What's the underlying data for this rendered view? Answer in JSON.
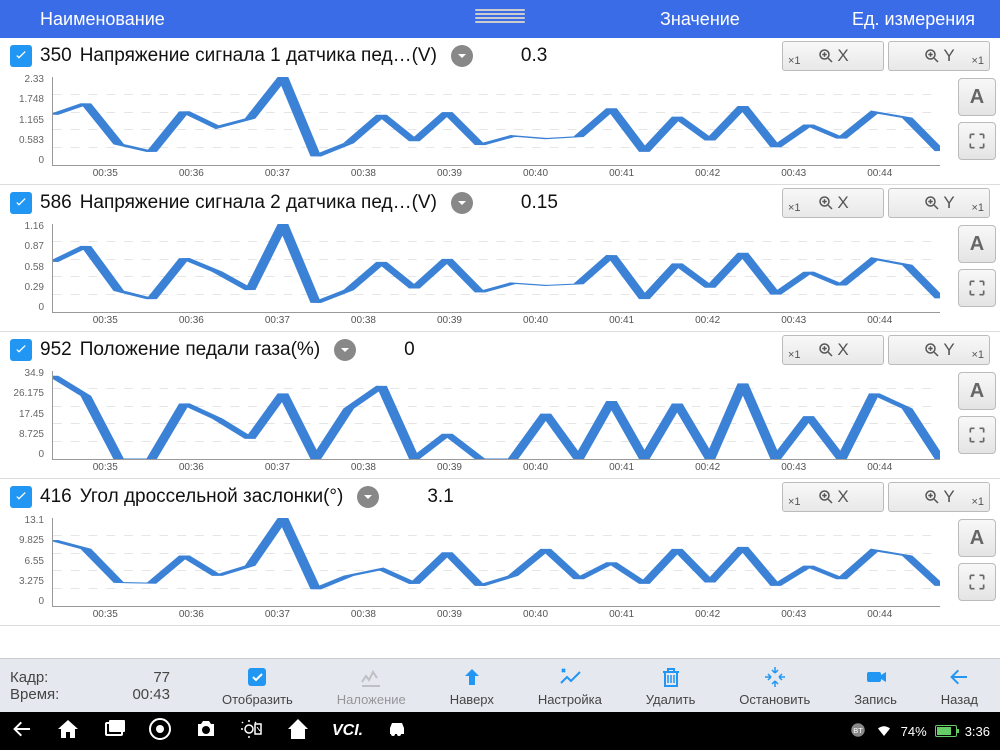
{
  "header": {
    "name": "Наименование",
    "value": "Значение",
    "unit": "Ед. измерения"
  },
  "zoom": {
    "xlabel": "X",
    "ylabel": "Y",
    "x1": "×1"
  },
  "panels": [
    {
      "id": "350",
      "name": "Напряжение сигнала 1 датчика пед…(V)",
      "value": "0.3",
      "yticks": [
        "2.33",
        "1.748",
        "1.165",
        "0.583",
        "0"
      ]
    },
    {
      "id": "586",
      "name": "Напряжение сигнала 2 датчика пед…(V)",
      "value": "0.15",
      "yticks": [
        "1.16",
        "0.87",
        "0.58",
        "0.29",
        "0"
      ]
    },
    {
      "id": "952",
      "name": "Положение педали газа(%)",
      "value": "0",
      "yticks": [
        "34.9",
        "26.175",
        "17.45",
        "8.725",
        "0"
      ]
    },
    {
      "id": "416",
      "name": "Угол дроссельной заслонки(°)",
      "value": "3.1",
      "yticks": [
        "13.1",
        "9.825",
        "6.55",
        "3.275",
        "0"
      ]
    }
  ],
  "xticks": [
    "00:35",
    "00:36",
    "00:37",
    "00:38",
    "00:39",
    "00:40",
    "00:41",
    "00:42",
    "00:43",
    "00:44"
  ],
  "chart_data": [
    {
      "type": "line",
      "title": "Напряжение сигнала 1 датчика пед…(V)",
      "ylim": [
        0,
        2.33
      ],
      "x": [
        "00:34.5",
        "00:34.8",
        "00:35.5",
        "00:35.8",
        "00:36.3",
        "00:36.7",
        "00:37.0",
        "00:37.3",
        "00:37.6",
        "00:38.0",
        "00:38.3",
        "00:38.6",
        "00:39.0",
        "00:39.3",
        "00:39.7",
        "00:40.0",
        "00:40.4",
        "00:40.7",
        "00:41.0",
        "00:41.4",
        "00:41.7",
        "00:42.0",
        "00:42.4",
        "00:42.7",
        "00:43.0",
        "00:43.4",
        "00:43.7",
        "00:44.0"
      ],
      "values": [
        1.33,
        1.63,
        0.55,
        0.35,
        1.42,
        1.0,
        1.23,
        2.33,
        0.23,
        0.58,
        1.33,
        0.63,
        1.4,
        0.53,
        0.77,
        0.7,
        0.75,
        1.5,
        0.35,
        1.28,
        0.65,
        1.56,
        0.47,
        1.07,
        0.7,
        1.4,
        1.25,
        0.37
      ]
    },
    {
      "type": "line",
      "title": "Напряжение сигнала 2 датчика пед…(V)",
      "ylim": [
        0,
        1.16
      ],
      "x": [
        "00:34.5",
        "00:34.8",
        "00:35.5",
        "00:35.8",
        "00:36.3",
        "00:36.7",
        "00:37.0",
        "00:37.3",
        "00:37.6",
        "00:38.0",
        "00:38.3",
        "00:38.6",
        "00:39.0",
        "00:39.3",
        "00:39.7",
        "00:40.0",
        "00:40.4",
        "00:40.7",
        "00:41.0",
        "00:41.4",
        "00:41.7",
        "00:42.0",
        "00:42.4",
        "00:42.7",
        "00:43.0",
        "00:43.4",
        "00:43.7",
        "00:44.0"
      ],
      "values": [
        0.66,
        0.87,
        0.28,
        0.17,
        0.71,
        0.53,
        0.29,
        1.16,
        0.12,
        0.29,
        0.66,
        0.31,
        0.7,
        0.26,
        0.38,
        0.35,
        0.37,
        0.75,
        0.17,
        0.64,
        0.32,
        0.78,
        0.23,
        0.53,
        0.35,
        0.7,
        0.62,
        0.18
      ]
    },
    {
      "type": "line",
      "title": "Положение педали газа(%)",
      "ylim": [
        0,
        34.9
      ],
      "x": [
        "00:34.5",
        "00:34.8",
        "00:35.5",
        "00:35.8",
        "00:36.3",
        "00:36.7",
        "00:37.0",
        "00:37.3",
        "00:37.6",
        "00:38.0",
        "00:38.3",
        "00:38.6",
        "00:39.0",
        "00:39.3",
        "00:39.7",
        "00:40.0",
        "00:40.4",
        "00:40.7",
        "00:41.0",
        "00:41.4",
        "00:41.7",
        "00:42.0",
        "00:42.4",
        "00:42.7",
        "00:43.0",
        "00:43.4",
        "00:43.7",
        "00:44.0"
      ],
      "values": [
        33,
        25,
        0,
        0,
        22,
        16,
        8,
        26,
        0,
        20,
        29,
        0,
        10,
        0,
        0,
        18,
        0,
        23,
        0,
        22,
        0,
        30,
        0,
        17,
        0,
        26,
        20,
        0
      ]
    },
    {
      "type": "line",
      "title": "Угол дроссельной заслонки(°)",
      "ylim": [
        0,
        13.1
      ],
      "x": [
        "00:34.5",
        "00:34.8",
        "00:35.5",
        "00:35.8",
        "00:36.3",
        "00:36.7",
        "00:37.0",
        "00:37.3",
        "00:37.6",
        "00:38.0",
        "00:38.3",
        "00:38.6",
        "00:39.0",
        "00:39.3",
        "00:39.7",
        "00:40.0",
        "00:40.4",
        "00:40.7",
        "00:41.0",
        "00:41.4",
        "00:41.7",
        "00:42.0",
        "00:42.4",
        "00:42.7",
        "00:43.0",
        "00:43.4",
        "00:43.7",
        "00:44.0"
      ],
      "values": [
        9.8,
        8.5,
        3.5,
        3.4,
        7.5,
        4.5,
        6.0,
        13.1,
        2.5,
        4.5,
        5.5,
        3.3,
        8.0,
        3.0,
        4.5,
        8.5,
        4.0,
        6.5,
        3.3,
        8.5,
        3.5,
        8.8,
        3.0,
        6.0,
        4.0,
        8.3,
        7.5,
        3.0
      ]
    }
  ],
  "footer": {
    "frame_lbl": "Кадр:",
    "frame_val": "77",
    "time_lbl": "Время:",
    "time_val": "00:43",
    "buttons": [
      "Отобразить",
      "Наложение",
      "Наверх",
      "Настройка",
      "Удалить",
      "Остановить",
      "Запись",
      "Назад"
    ]
  },
  "status": {
    "battery": "74%",
    "time": "3:36"
  }
}
